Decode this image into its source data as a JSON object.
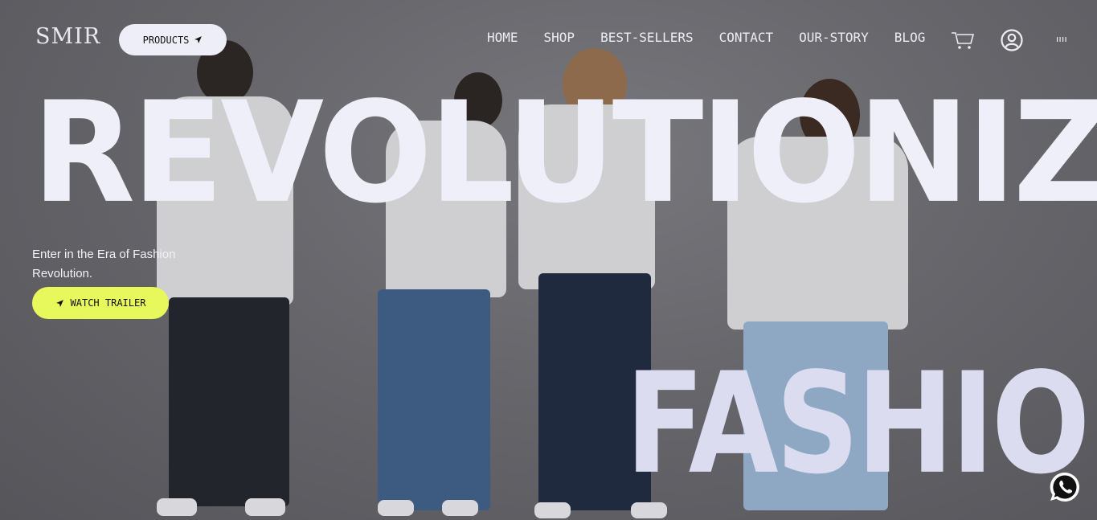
{
  "header": {
    "logo_text": "SMIR",
    "products_label": "PRODUCTS",
    "nav": [
      "HOME",
      "SHOP",
      "BEST-SELLERS",
      "CONTACT",
      "OUR-STORY",
      "BLOG"
    ],
    "icons": [
      "cart-icon",
      "account-icon",
      "menu-icon"
    ]
  },
  "hero": {
    "headline_top": "REVOLUTIONIZE",
    "headline_bottom": "FASHION",
    "subtitle": "Enter in the Era of Fashion Revolution.",
    "cta_label": "WATCH TRAILER"
  },
  "floating": {
    "icon": "whatsapp-icon"
  },
  "colors": {
    "cta_background": "#e6f85c",
    "products_background": "#eeeef8",
    "headline": "#eeeff8",
    "overlay": "#5f5f64"
  }
}
